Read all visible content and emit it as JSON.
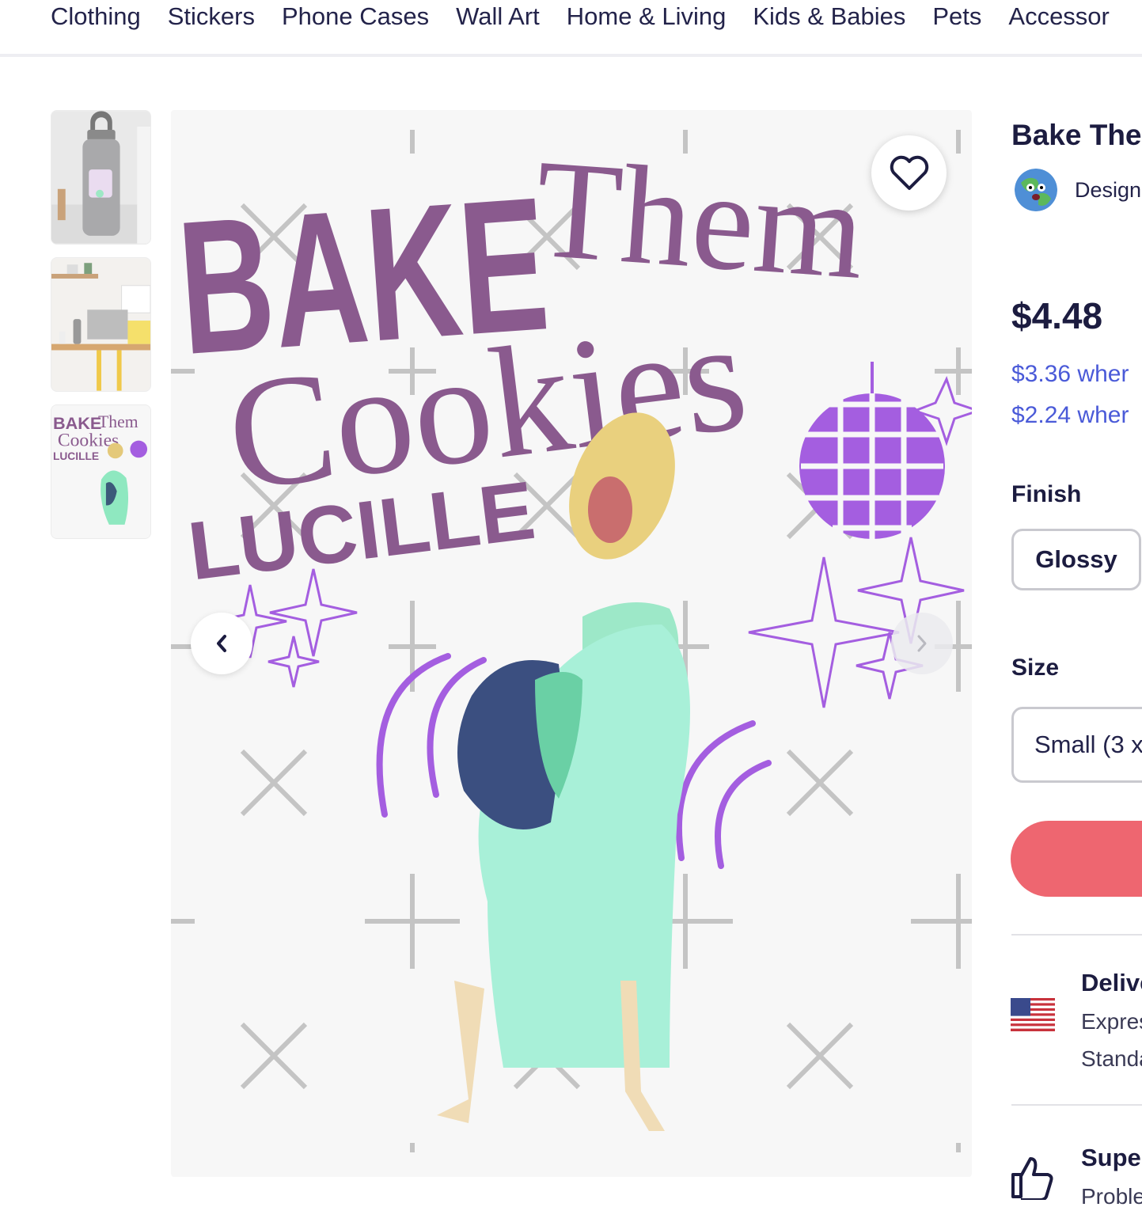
{
  "nav": {
    "items": [
      "Clothing",
      "Stickers",
      "Phone Cases",
      "Wall Art",
      "Home & Living",
      "Kids & Babies",
      "Pets",
      "Accessor"
    ]
  },
  "gallery": {
    "artwork_text": {
      "line1_bold": "BAKE",
      "line1_script": "Them",
      "line2": "Cookies",
      "line3": "LUCILLE"
    },
    "thumbnail_text": {
      "t1": "BAKE",
      "t2": "Them",
      "t3": "Cookies",
      "t4": "LUCILLE"
    }
  },
  "product": {
    "title": "Bake The",
    "designer_text": "Design",
    "price": "$4.48",
    "tier1": "$3.36 wher",
    "tier2": "$2.24 wher",
    "finish_label": "Finish",
    "finish_option": "Glossy",
    "size_label": "Size",
    "size_value": "Small (3 x"
  },
  "delivery": {
    "title": "Delive",
    "line1": "Expres",
    "line2": "Standa"
  },
  "support": {
    "title": "Supe",
    "line1": "Proble"
  },
  "colors": {
    "accent_purple": "#8a5a8e",
    "disco_purple": "#a45ee0",
    "price_blue": "#4a5ad8",
    "cart_red": "#ee6670",
    "text_dark": "#1c1c40"
  }
}
